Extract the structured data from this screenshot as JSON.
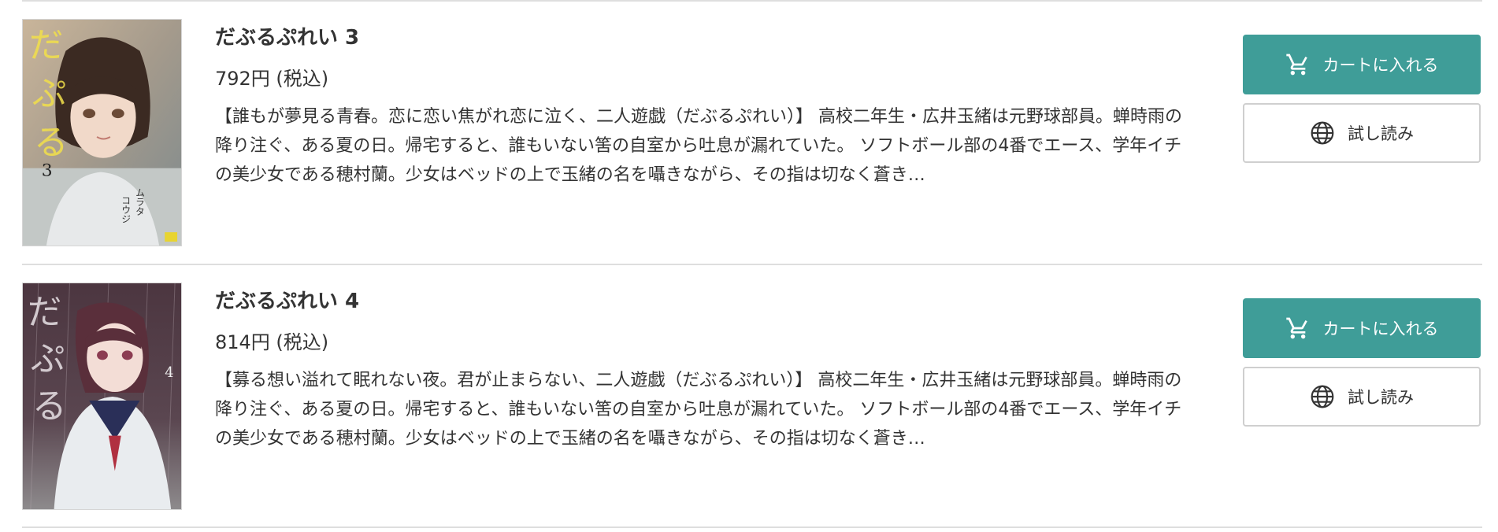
{
  "items": [
    {
      "title": "だぶるぷれい 3",
      "price": "792円 (税込)",
      "description": "【誰もが夢見る青春。恋に恋い焦がれ恋に泣く、二人遊戯（だぶるぷれい）】 高校二年生・広井玉緒は元野球部員。蝉時雨の降り注ぐ、ある夏の日。帰宅すると、誰もいない筈の自室から吐息が漏れていた。 ソフトボール部の4番でエース、学年イチの美少女である穂村蘭。少女はベッドの上で玉緒の名を囁きながら、その指は切なく蒼き…",
      "cover": {
        "volume_number": "3",
        "author_vertical": "ムラタコウジ",
        "icon": "book-cover-image"
      },
      "cart_label": "カートに入れる",
      "trial_label": "試し読み"
    },
    {
      "title": "だぶるぷれい 4",
      "price": "814円 (税込)",
      "description": "【募る想い溢れて眠れない夜。君が止まらない、二人遊戯（だぶるぷれい）】 高校二年生・広井玉緒は元野球部員。蝉時雨の降り注ぐ、ある夏の日。帰宅すると、誰もいない筈の自室から吐息が漏れていた。 ソフトボール部の4番でエース、学年イチの美少女である穂村蘭。少女はベッドの上で玉緒の名を囁きながら、その指は切なく蒼き…",
      "cover": {
        "volume_number": "4",
        "icon": "book-cover-image"
      },
      "cart_label": "カートに入れる",
      "trial_label": "試し読み"
    }
  ],
  "icons": {
    "cart": "cart-icon",
    "trial": "globe-icon"
  },
  "colors": {
    "accent": "#3f9d98",
    "text": "#333333",
    "divider": "#dedede",
    "button_border": "#cfcfcf"
  }
}
